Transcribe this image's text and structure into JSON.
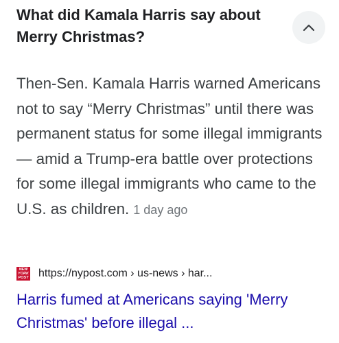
{
  "question": {
    "title": "What did Kamala Harris say about Merry Christmas?",
    "toggle_icon": "chevron-up-icon"
  },
  "answer": {
    "text": "Then-Sen. Kamala Harris warned Americans not to say “Merry Christmas” until there was permanent status for some illegal immigrants — amid a Trump-era battle over protections for some illegal immigrants who came to the U.S. as children.",
    "date": "1 day ago"
  },
  "source": {
    "favicon_label": "NEW YORK POST",
    "favicon_color": "#c8102e",
    "url": "https://nypost.com › us-news › har..."
  },
  "result": {
    "title": "Harris fumed at Americans saying 'Merry Christmas' before illegal ...",
    "link_color": "#1a0dab"
  }
}
